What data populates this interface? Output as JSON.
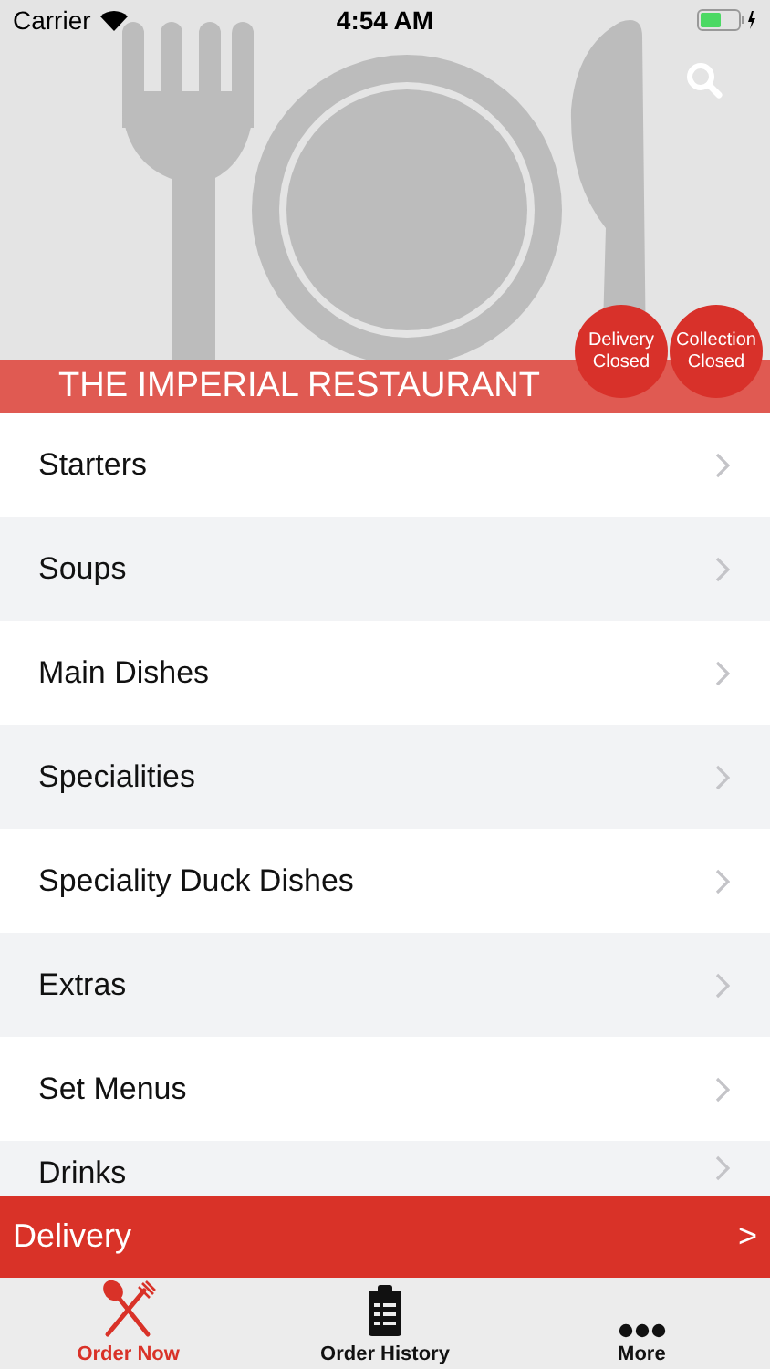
{
  "status_bar": {
    "carrier": "Carrier",
    "time": "4:54 AM"
  },
  "header": {
    "kind": "picture",
    "restaurant_name": "THE IMPERIAL RESTAURANT",
    "badges": [
      {
        "line1": "Delivery",
        "line2": "Closed"
      },
      {
        "line1": "Collection",
        "line2": "Closed"
      }
    ]
  },
  "categories": [
    {
      "label": "Starters"
    },
    {
      "label": "Soups"
    },
    {
      "label": "Main Dishes"
    },
    {
      "label": "Specialities"
    },
    {
      "label": "Speciality Duck Dishes"
    },
    {
      "label": "Extras"
    },
    {
      "label": "Set Menus"
    },
    {
      "label": "Drinks"
    }
  ],
  "order_bar": {
    "label": "Delivery",
    "arrow": ">"
  },
  "tabs": [
    {
      "label": "Order Now",
      "kind": "cutlery",
      "selected": true
    },
    {
      "label": "Order History",
      "kind": "clipboard",
      "selected": false
    },
    {
      "label": "More",
      "kind": "dots",
      "selected": false
    }
  ]
}
